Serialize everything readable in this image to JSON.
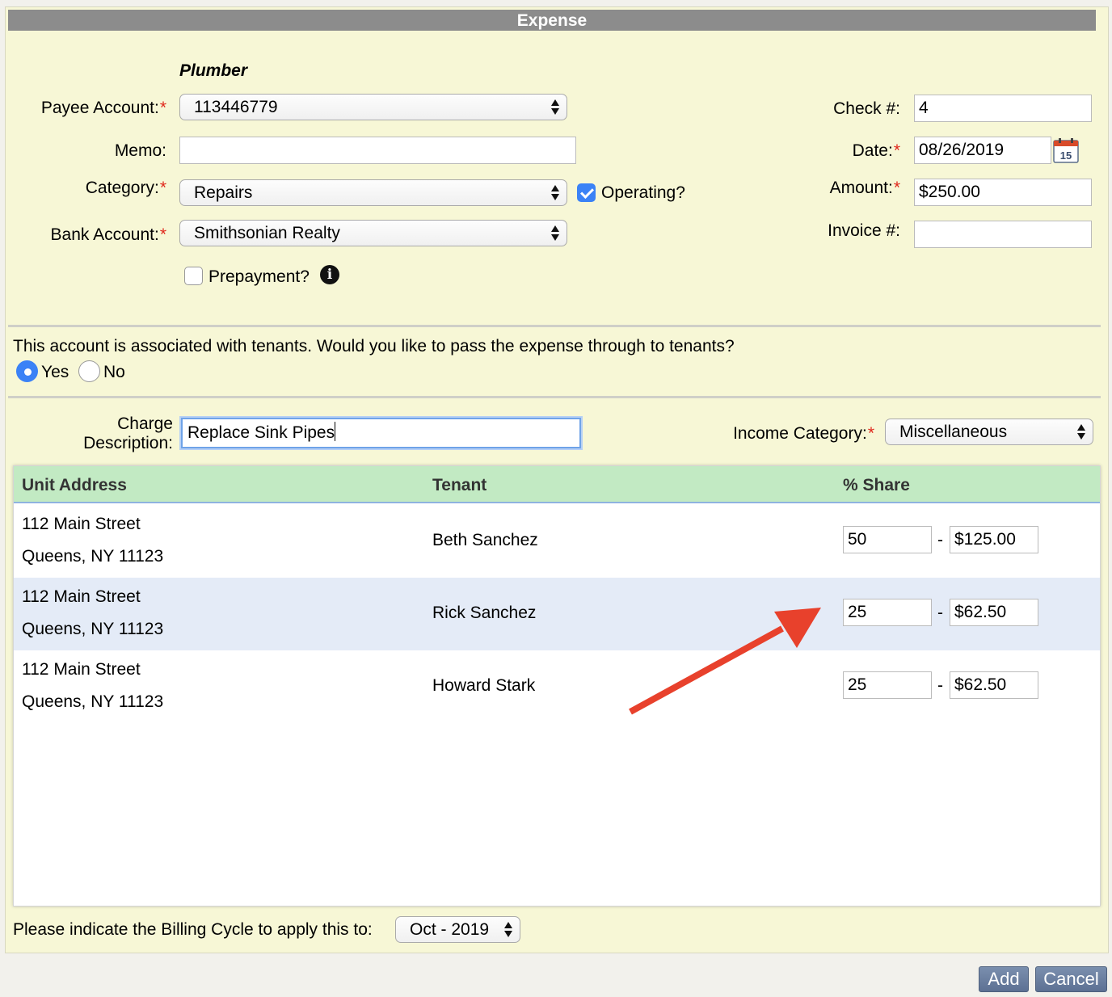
{
  "dialog": {
    "title": "Expense"
  },
  "payee": {
    "name": "Plumber",
    "account_label": "Payee Account:",
    "account_value": "113446779"
  },
  "memo": {
    "label": "Memo:",
    "value": ""
  },
  "category": {
    "label": "Category:",
    "value": "Repairs",
    "operating_label": "Operating?",
    "operating_checked": true
  },
  "bank": {
    "label": "Bank Account:",
    "value": "Smithsonian Realty"
  },
  "prepayment": {
    "label": "Prepayment?",
    "checked": false
  },
  "check": {
    "label": "Check #:",
    "value": "4"
  },
  "date": {
    "label": "Date:",
    "value": "08/26/2019"
  },
  "amount": {
    "label": "Amount:",
    "value": "$250.00"
  },
  "invoice": {
    "label": "Invoice #:",
    "value": ""
  },
  "required_mark": "*",
  "passthrough": {
    "question": "This account is associated with tenants. Would you like to pass the expense through to tenants?",
    "yes_label": "Yes",
    "no_label": "No",
    "selected": "Yes"
  },
  "charge": {
    "label_line1": "Charge",
    "label_line2": "Description:",
    "value": "Replace Sink Pipes"
  },
  "income_category": {
    "label": "Income Category:",
    "value": "Miscellaneous"
  },
  "table": {
    "headers": [
      "Unit Address",
      "Tenant",
      "% Share"
    ],
    "rows": [
      {
        "address1": "112 Main Street",
        "address2": "Queens, NY 11123",
        "tenant": "Beth Sanchez",
        "share": "50",
        "amount": "$125.00"
      },
      {
        "address1": "112 Main Street",
        "address2": "Queens, NY 11123",
        "tenant": "Rick Sanchez",
        "share": "25",
        "amount": "$62.50"
      },
      {
        "address1": "112 Main Street",
        "address2": "Queens, NY 11123",
        "tenant": "Howard Stark",
        "share": "25",
        "amount": "$62.50"
      }
    ],
    "separator": "-"
  },
  "billing": {
    "label": "Please indicate the Billing Cycle to apply this to:",
    "value": "Oct - 2019"
  },
  "buttons": {
    "add": "Add",
    "cancel": "Cancel"
  },
  "icons": {
    "info": "info-icon",
    "calendar": "calendar-icon",
    "calendar_day": "15"
  },
  "colors": {
    "accent": "#3b82f6",
    "header_green": "#c2eac3",
    "annotation_arrow": "#e8412c"
  }
}
